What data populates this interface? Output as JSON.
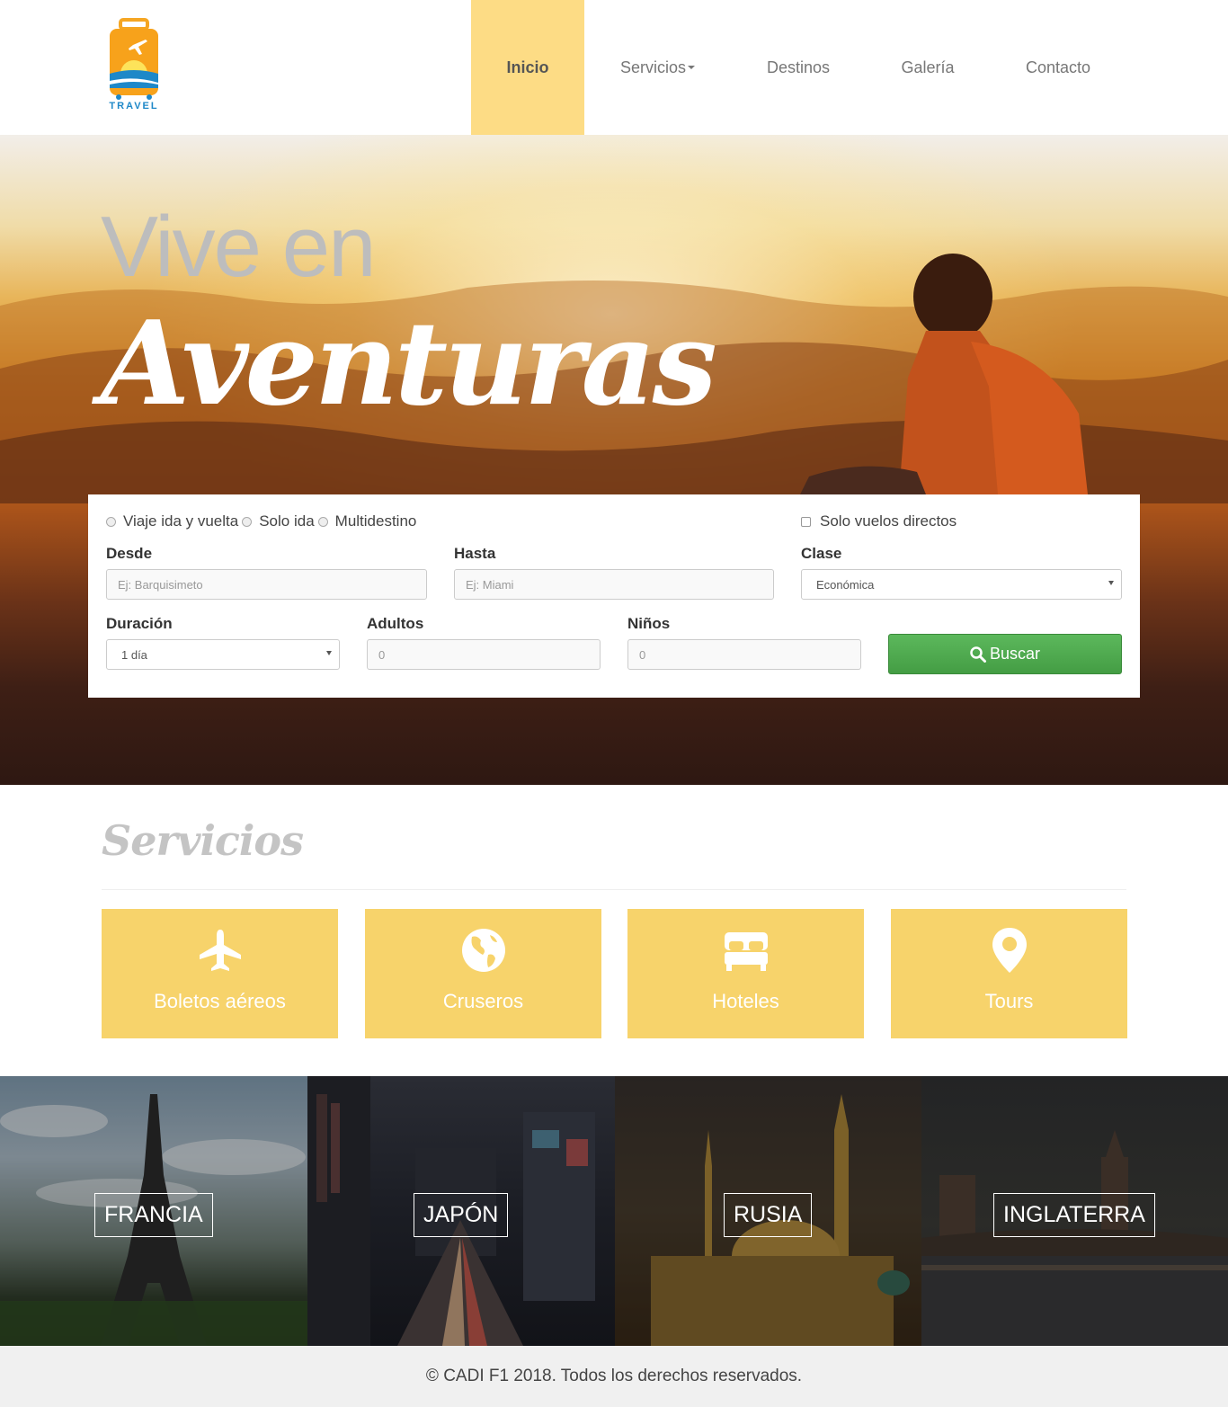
{
  "brand": {
    "logo_text": "TRAVEL"
  },
  "nav": {
    "items": [
      {
        "label": "Inicio",
        "active": true
      },
      {
        "label": "Servicios",
        "dropdown": true
      },
      {
        "label": "Destinos"
      },
      {
        "label": "Galería"
      },
      {
        "label": "Contacto"
      }
    ]
  },
  "hero": {
    "title_line1": "Vive en",
    "title_line2": "Aventuras"
  },
  "search": {
    "trip_types": [
      "Viaje ida y vuelta",
      "Solo ida",
      "Multidestino"
    ],
    "direct_flights_label": "Solo vuelos directos",
    "desde": {
      "label": "Desde",
      "placeholder": "Ej: Barquisimeto"
    },
    "hasta": {
      "label": "Hasta",
      "placeholder": "Ej: Miami"
    },
    "clase": {
      "label": "Clase",
      "value": "Económica"
    },
    "duracion": {
      "label": "Duración",
      "value": "1 día"
    },
    "adultos": {
      "label": "Adultos",
      "placeholder": "0"
    },
    "ninos": {
      "label": "Niños",
      "placeholder": "0"
    },
    "button_label": "Buscar",
    "button_icon": "search-icon"
  },
  "services": {
    "title": "Servicios",
    "items": [
      {
        "label": "Boletos aéreos",
        "icon": "plane-icon"
      },
      {
        "label": "Cruseros",
        "icon": "globe-icon"
      },
      {
        "label": "Hoteles",
        "icon": "bed-icon"
      },
      {
        "label": "Tours",
        "icon": "map-marker-icon"
      }
    ]
  },
  "destinations": [
    {
      "label": "FRANCIA"
    },
    {
      "label": "JAPÓN"
    },
    {
      "label": "RUSIA"
    },
    {
      "label": "INGLATERRA"
    }
  ],
  "footer": {
    "text": "© CADI F1 2018. Todos los derechos reservados."
  },
  "colors": {
    "accent_yellow": "#fddc85",
    "service_card": "#f7d36b",
    "button_green": "#4cae4c"
  }
}
